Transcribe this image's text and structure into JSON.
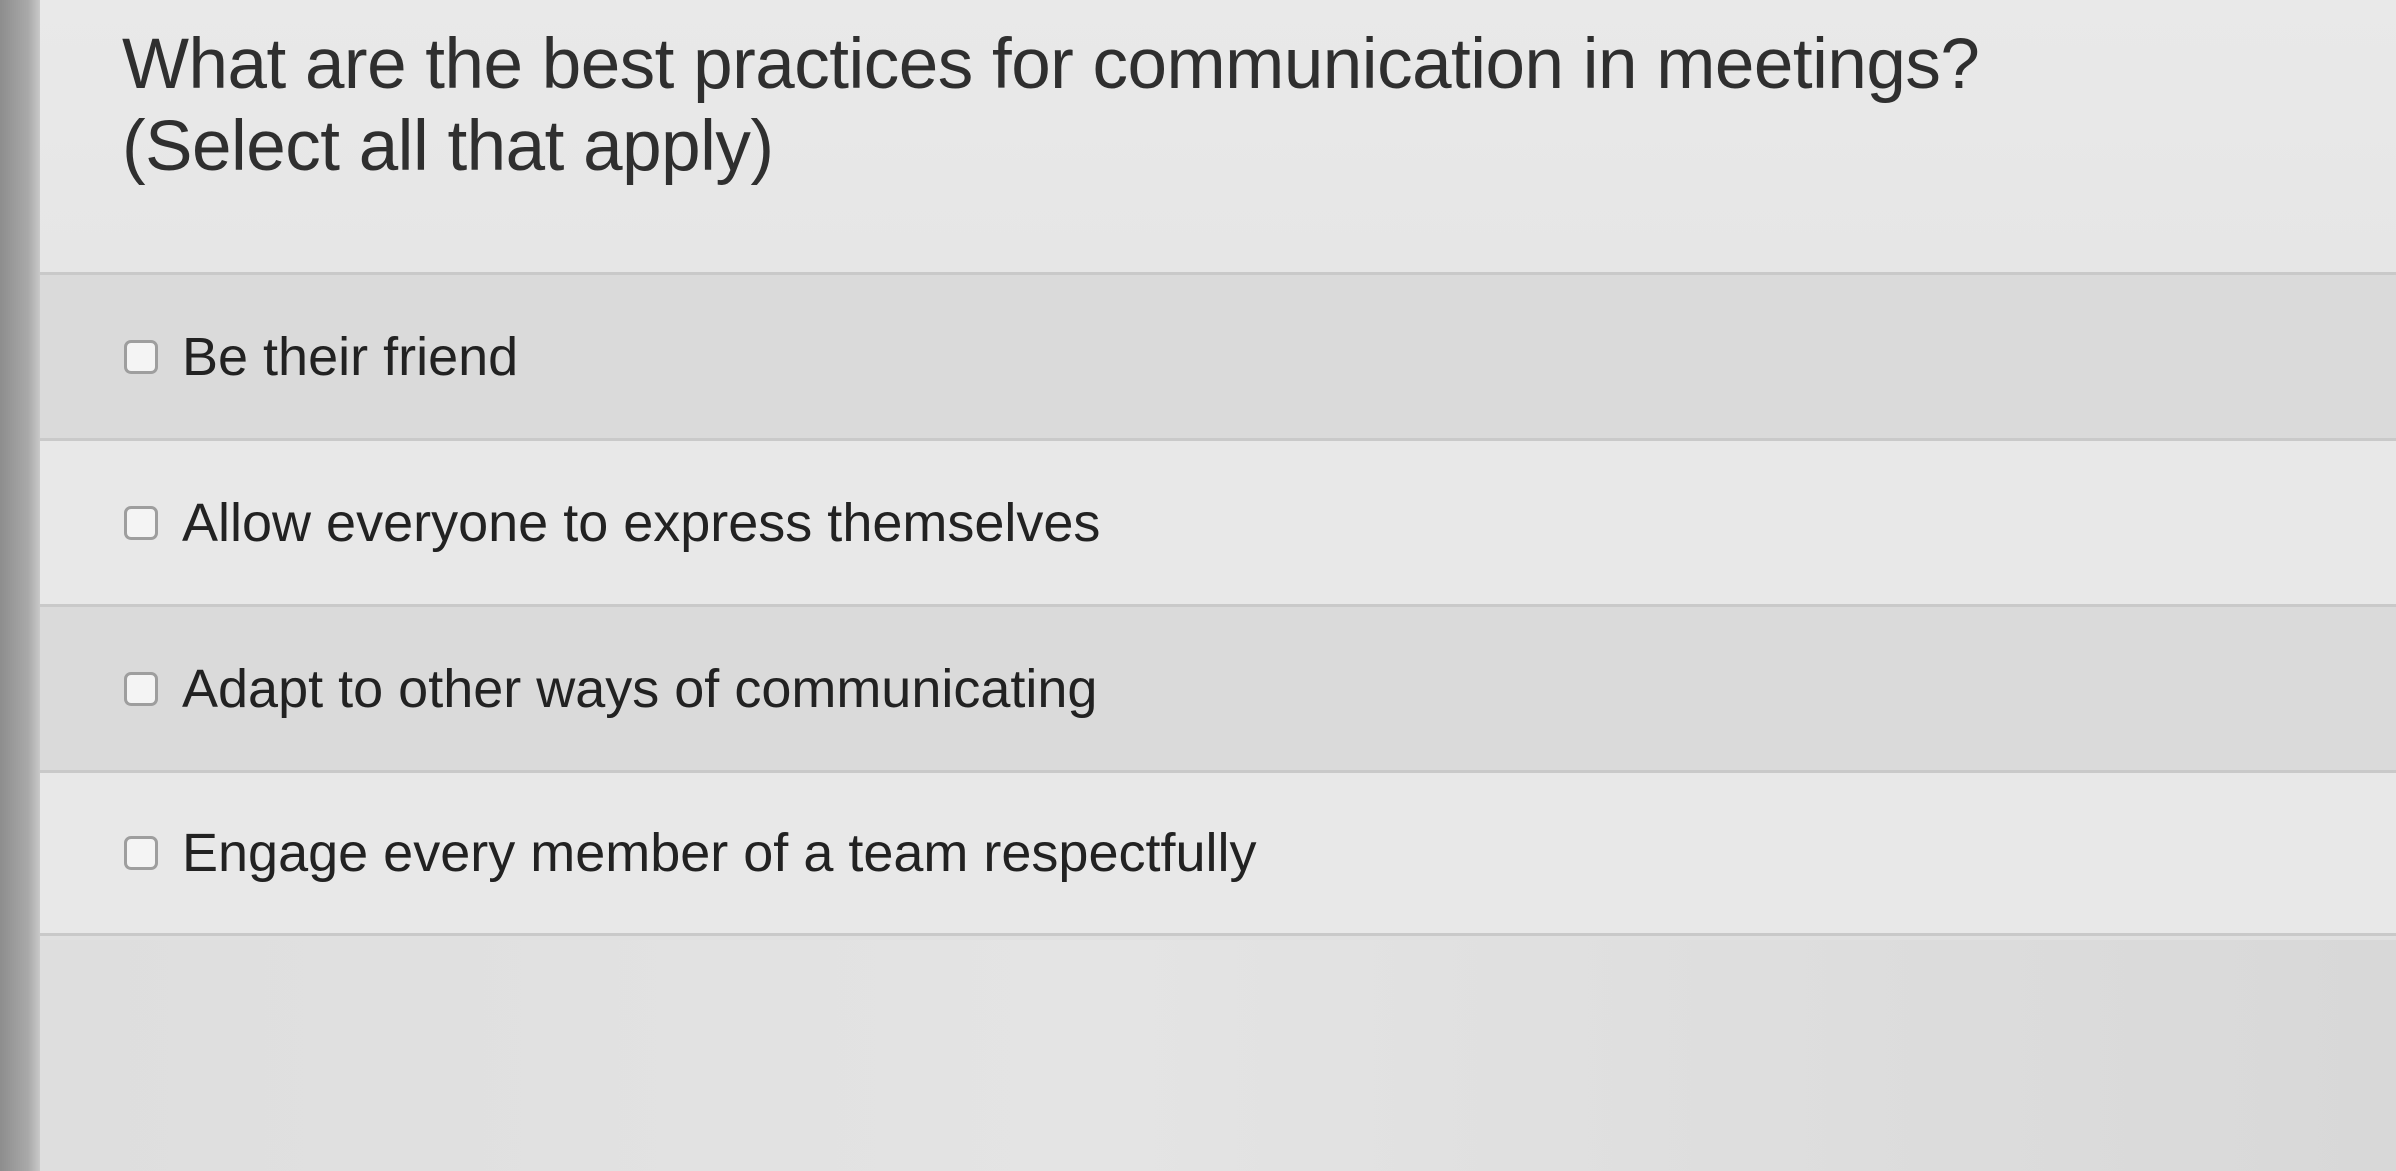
{
  "question": {
    "line1": "What are the best practices for communication in meetings?",
    "line2": "(Select all that apply)"
  },
  "options": [
    {
      "label": "Be their friend",
      "checked": false
    },
    {
      "label": "Allow everyone to express themselves",
      "checked": false
    },
    {
      "label": "Adapt to other ways of communicating",
      "checked": false
    },
    {
      "label": "Engage every member of a team respectfully",
      "checked": false
    }
  ]
}
